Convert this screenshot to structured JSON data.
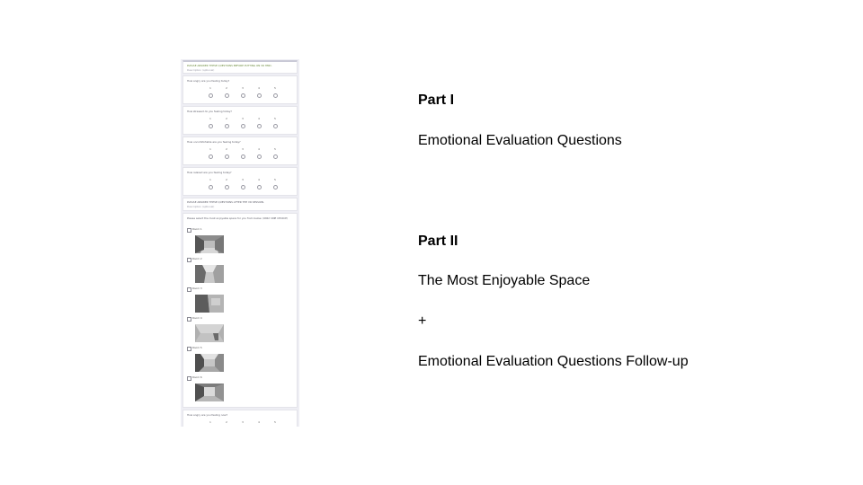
{
  "form": {
    "header_title": "PLEASE ANSWER THESE QUESTIONS BEFORE PUTTING ON VR HMD.",
    "header_hint": "Description (optional)",
    "scale_labels": [
      "1",
      "2",
      "3",
      "4",
      "5"
    ],
    "questions": [
      "How angry are you feeling today?",
      "How stressed do you feeling today?",
      "How uncomfortable are you feeling today?",
      "How relaxed are you feeling today?"
    ],
    "section_title": "PLEASE ANSWER THESE QUESTIONS AFTER THE VR SESSION.",
    "section_hint": "Description (optional)",
    "choice_question": "Please select the most enjoyable space for you from below. (ONLY ONE CHOICE)",
    "rooms": [
      "Room 1",
      "Room 2",
      "Room 3",
      "Room 4",
      "Room 5",
      "Room 6"
    ],
    "followup_question": "How angry are you feeling now?"
  },
  "right": {
    "part1_heading": "Part I",
    "part1_text": "Emotional Evaluation Questions",
    "part2_heading": "Part II",
    "part2_line1": "The Most Enjoyable Space",
    "part2_plus": "+",
    "part2_line2": "Emotional Evaluation Questions Follow-up"
  }
}
